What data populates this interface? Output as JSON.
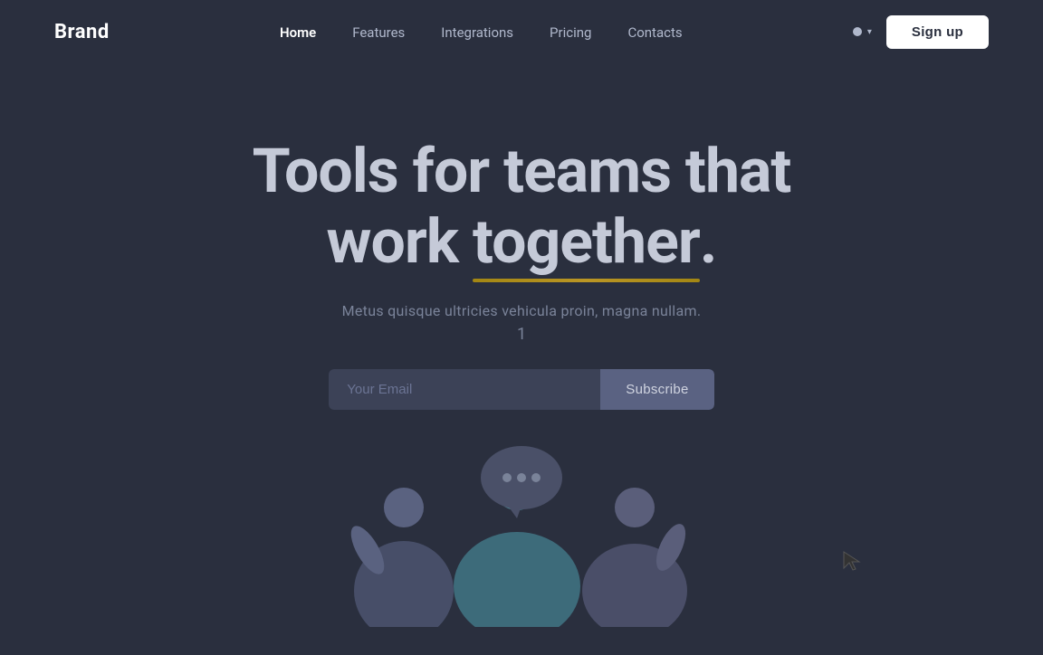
{
  "brand": {
    "name": "Brand"
  },
  "nav": {
    "links": [
      {
        "label": "Home",
        "active": true
      },
      {
        "label": "Features",
        "active": false
      },
      {
        "label": "Integrations",
        "active": false
      },
      {
        "label": "Pricing",
        "active": false
      },
      {
        "label": "Contacts",
        "active": false
      }
    ],
    "signup_label": "Sign up",
    "dot_label": ""
  },
  "hero": {
    "title_line1": "Tools for teams that",
    "title_line2_plain": "work ",
    "title_line2_highlight": "together",
    "title_line2_end": ".",
    "subtitle": "Metus quisque ultricies vehicula proin, magna nullam.",
    "counter": "1",
    "email_placeholder": "Your Email",
    "subscribe_label": "Subscribe"
  },
  "illustration": {
    "dots": [
      "•",
      "•",
      "•"
    ]
  }
}
